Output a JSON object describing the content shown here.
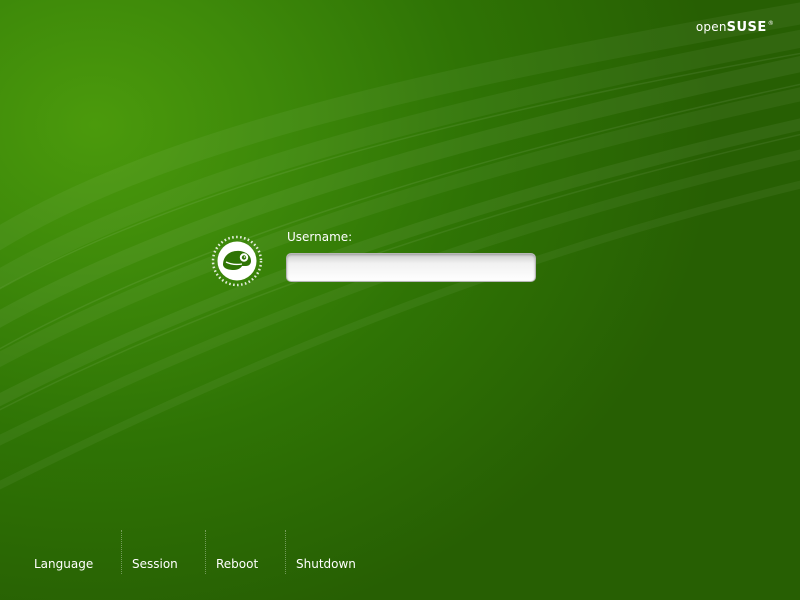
{
  "brand": {
    "prefix": "open",
    "name": "SUSE",
    "trademark": "®"
  },
  "login": {
    "username_label": "Username:",
    "username_value": "",
    "avatar_icon": "opensuse-chameleon-icon"
  },
  "bottom_bar": {
    "language_label": "Language",
    "session_label": "Session",
    "reboot_label": "Reboot",
    "shutdown_label": "Shutdown"
  },
  "colors": {
    "background_light": "#4b9a0c",
    "background_dark": "#275f03",
    "text": "#ffffff"
  }
}
